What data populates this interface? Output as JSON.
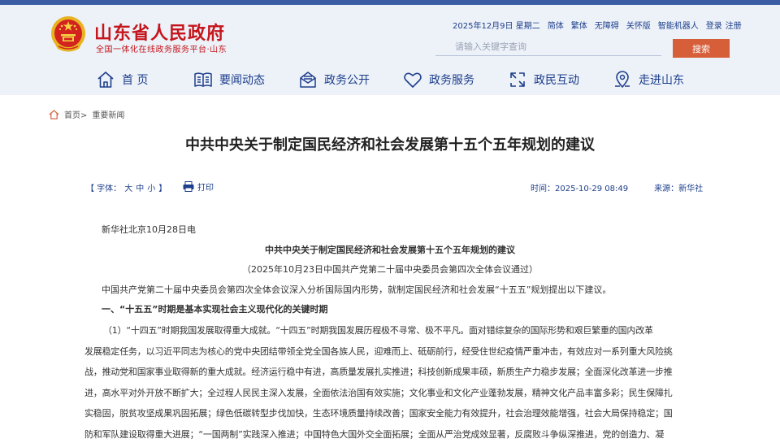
{
  "colors": {
    "brand_red": "#c4161c",
    "nav_blue": "#1c3f8c",
    "top_bar": "#3a5da3",
    "search_button": "#d65f3a",
    "header_bg": "#edf1f8"
  },
  "header": {
    "site_title": "山东省人民政府",
    "site_subtitle": "全国一体化在线政务服务平台·山东",
    "top_links": [
      "2025年12月9日 星期二",
      "简体",
      "繁体",
      "无障碍",
      "关怀版",
      "智能机器人",
      "登录",
      "注册"
    ],
    "search": {
      "placeholder": "请输入关键字查询",
      "button_label": "搜索"
    }
  },
  "nav": [
    {
      "label": "首 页",
      "icon": "home-icon"
    },
    {
      "label": "要闻动态",
      "icon": "book-icon"
    },
    {
      "label": "政务公开",
      "icon": "envelope-icon"
    },
    {
      "label": "政务服务",
      "icon": "heart-icon"
    },
    {
      "label": "政民互动",
      "icon": "interaction-icon"
    },
    {
      "label": "走进山东",
      "icon": "map-pin-icon"
    }
  ],
  "breadcrumb": {
    "home": "首页>",
    "current": "重要新闻"
  },
  "article": {
    "title": "中共中央关于制定国民经济和社会发展第十五个五年规划的建议",
    "font_label": "【 字体：",
    "font_sizes": [
      "大",
      "中",
      "小"
    ],
    "font_end": "】",
    "print_label": "打印",
    "time_label": "时间：",
    "time_value": "2025-10-29 08:49",
    "source_label": "来源：",
    "source_value": "新华社",
    "dateline": "新华社北京10月28日电",
    "doc_title": "中共中央关于制定国民经济和社会发展第十五个五年规划的建议",
    "doc_subtitle": "（2025年10月23日中国共产党第二十届中央委员会第四次全体会议通过）",
    "intro": "中国共产党第二十届中央委员会第四次全体会议深入分析国际国内形势，就制定国民经济和社会发展“十五五”规划提出以下建议。",
    "section1": "一、“十五五”时期是基本实现社会主义现代化的关键时期",
    "lines": [
      "（1）“十四五”时期我国发展取得重大成就。“十四五”时期我国发展历程极不寻常、极不平凡。面对错综复杂的国际形势和艰巨繁重的国内改革",
      "发展稳定任务，以习近平同志为核心的党中央团结带领全党全国各族人民，迎难而上、砥砺前行，经受住世纪疫情严重冲击，有效应对一系列重大风险挑",
      "战，推动党和国家事业取得新的重大成就。经济运行稳中有进，高质量发展扎实推进；科技创新成果丰硕，新质生产力稳步发展；全面深化改革进一步推",
      "进，高水平对外开放不断扩大；全过程人民民主深入发展，全面依法治国有效实施；文化事业和文化产业蓬勃发展，精神文化产品丰富多彩；民生保障扎",
      "实稳固，脱贫攻坚成果巩固拓展；绿色低碳转型步伐加快，生态环境质量持续改善；国家安全能力有效提升，社会治理效能增强，社会大局保持稳定；国",
      "防和军队建设取得重大进展；“一国两制”实践深入推进；中国特色大国外交全面拓展；全面从严治党成效显著，反腐败斗争纵深推进，党的创造力、凝"
    ]
  }
}
